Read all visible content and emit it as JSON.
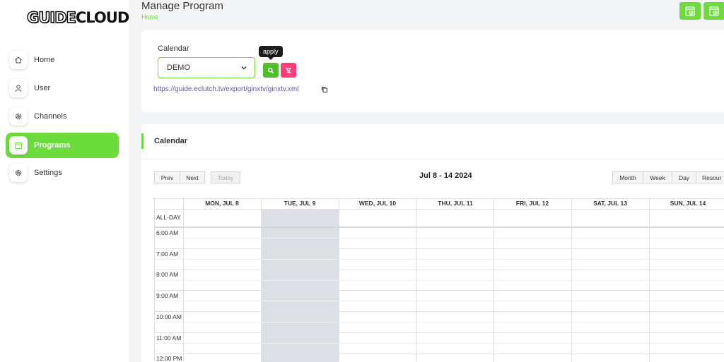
{
  "sidebar": {
    "logo_part1": "GUIDE",
    "logo_part2": "CLOUD",
    "items": [
      {
        "label": "Home",
        "icon": "home-icon"
      },
      {
        "label": "User",
        "icon": "user-icon"
      },
      {
        "label": "Channels",
        "icon": "gear-icon"
      },
      {
        "label": "Programs",
        "icon": "calendar-icon",
        "active": true
      },
      {
        "label": "Settings",
        "icon": "gear-icon"
      }
    ]
  },
  "header": {
    "title": "Manage Program",
    "breadcrumb": "Home"
  },
  "filter": {
    "calendar_label": "Calendar",
    "calendar_value": "DEMO",
    "tooltip": "apply",
    "feed_url": "https://guide.eclutch.tv/export/ginxtv/ginxtv.xml"
  },
  "calendar": {
    "title": "Calendar",
    "range": "Jul 8 - 14 2024",
    "nav": {
      "prev": "Prev",
      "next": "Next",
      "today": "Today"
    },
    "views": {
      "month": "Month",
      "week": "Week",
      "day": "Day",
      "resource": "Resour"
    },
    "days": [
      "MON, JUL 8",
      "TUE, JUL 9",
      "WED, JUL 10",
      "THU, JUL 11",
      "FRI, JUL 12",
      "SAT, JUL 13",
      "SUN, JUL 14"
    ],
    "all_day": "ALL-DAY",
    "times": [
      "6:00 AM",
      "7:00 AM",
      "8:00 AM",
      "9:00 AM",
      "10:00 AM",
      "11:00 AM",
      "12:00 PM"
    ]
  },
  "colors": {
    "accent": "#6cdc3d",
    "danger": "#ff3d78",
    "link": "#5e5a9e",
    "today_shade": "#dcdfe3"
  }
}
